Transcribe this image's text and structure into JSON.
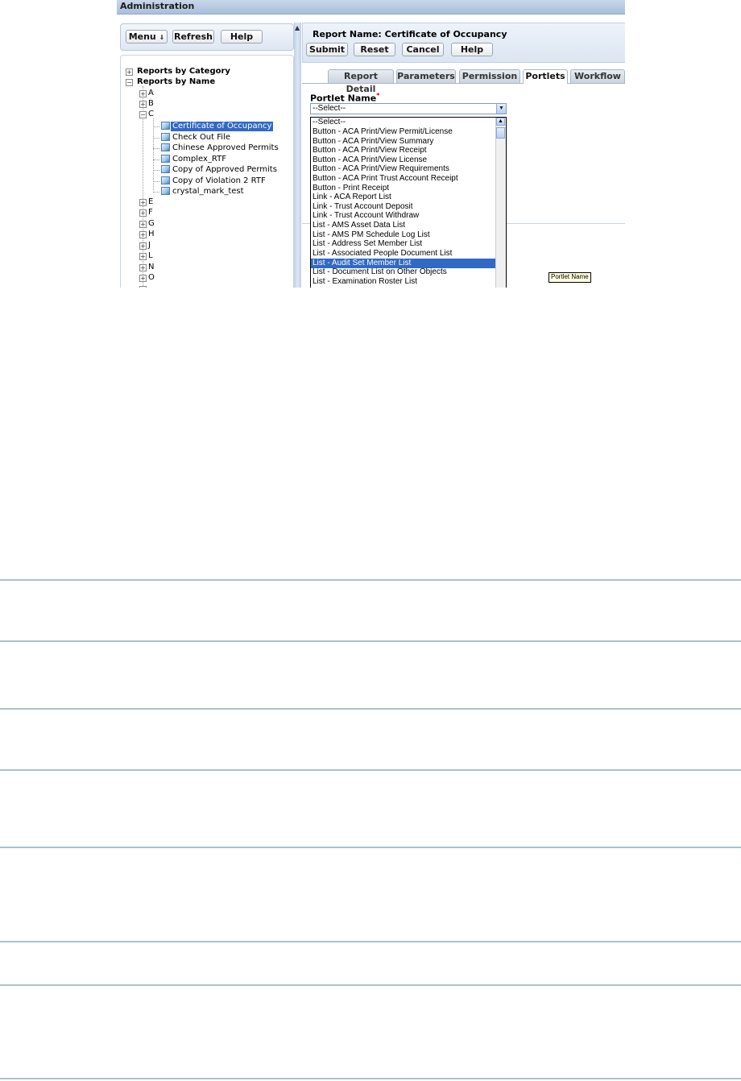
{
  "window": {
    "title": "Administration"
  },
  "left_toolbar": {
    "menu": "Menu",
    "refresh": "Refresh",
    "help": "Help",
    "menu_icon": "double-chevron-down-icon"
  },
  "tree": {
    "by_category": "Reports by Category",
    "by_name": "Reports by Name",
    "letters_before": [
      "A",
      "B",
      "C"
    ],
    "c_items": [
      "Certificate of Occupancy",
      "Check Out File",
      "Chinese Approved Permits",
      "Complex_RTF",
      "Copy of Approved Permits",
      "Copy of Violation 2 RTF",
      "crystal_mark_test"
    ],
    "selected_item": "Certificate of Occupancy",
    "letters_after": [
      "E",
      "F",
      "G",
      "H",
      "J",
      "L",
      "N",
      "O"
    ]
  },
  "report": {
    "name_label": "Report Name: Certificate of Occupancy",
    "buttons": {
      "submit": "Submit",
      "reset": "Reset",
      "cancel": "Cancel",
      "help": "Help"
    }
  },
  "tabs": [
    "Report Detail",
    "Parameters",
    "Permission",
    "Portlets",
    "Workflow"
  ],
  "active_tab": "Portlets",
  "portlet": {
    "label": "Portlet Name",
    "required_mark": "*",
    "selected_value": "--Select--",
    "options": [
      "--Select--",
      "Button - ACA Print/View Permit/License",
      "Button - ACA Print/View Summary",
      "Button - ACA Print/View Receipt",
      "Button - ACA Print/View License",
      "Button - ACA Print/View Requirements",
      "Button - ACA Print Trust Account Receipt",
      "Button - Print Receipt",
      "Link - ACA Report List",
      "Link - Trust Account Deposit",
      "Link - Trust Account Withdraw",
      "List - AMS Asset Data List",
      "List - AMS PM Schedule Log List",
      "List - Address Set Member List",
      "List - Associated People Document List",
      "List - Audit Set Member List",
      "List - Document List on Other Objects",
      "List - Examination Roster List"
    ],
    "highlighted_option": "List - Audit Set Member List",
    "tooltip": "Portlet Name"
  }
}
